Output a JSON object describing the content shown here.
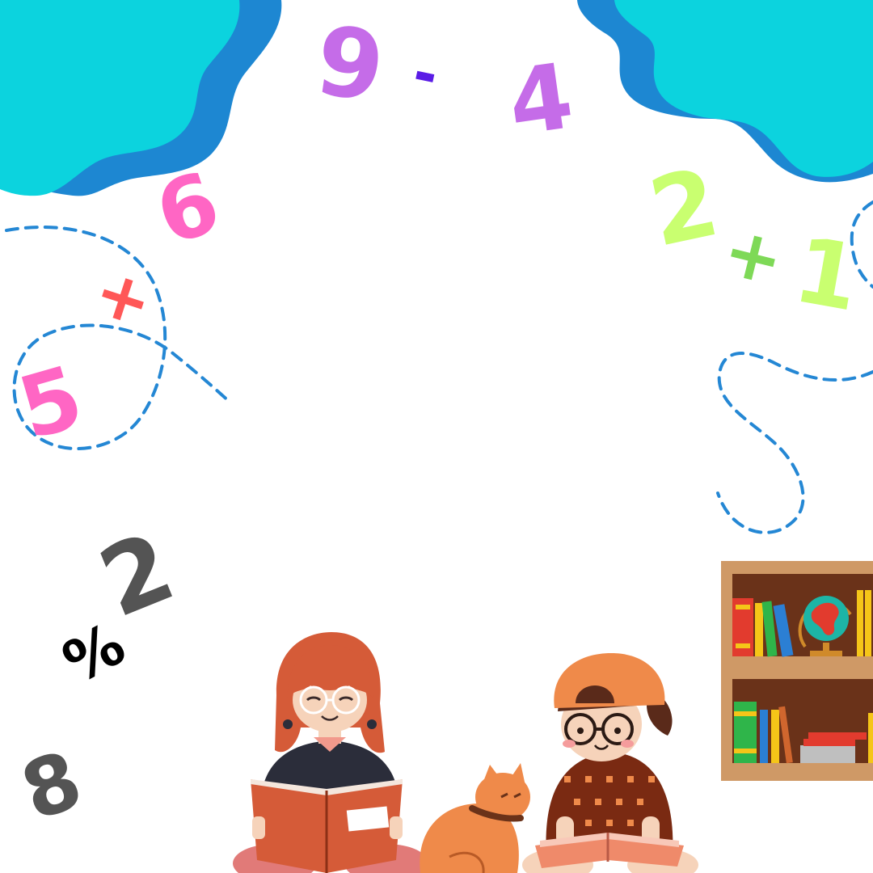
{
  "colors": {
    "background": "#ffffff",
    "blob_light": "#0cd3de",
    "blob_dark": "#1d87d2",
    "dashed_line": "#2487d4",
    "purple": "#c56ce8",
    "violet": "#5a1ce6",
    "pink": "#ff66c4",
    "lime": "#c9ff70",
    "green": "#7ed957",
    "red": "#ff5757",
    "dark_gray": "#545454",
    "black": "#000000"
  },
  "glyphs": {
    "nine": "9",
    "minus": "-",
    "four": "4",
    "six": "6",
    "two_top": "2",
    "plus_top": "+",
    "one": "1",
    "plus_left": "+",
    "five": "5",
    "two_bottom": "2",
    "divide": "%",
    "eight": "8"
  },
  "illustrations": {
    "girl_reading": "girl-reading-book-illustration",
    "boy_reading": "boy-reading-book-illustration",
    "cat": "cat-illustration",
    "bookshelf": "bookshelf-illustration",
    "globe": "globe-icon"
  }
}
